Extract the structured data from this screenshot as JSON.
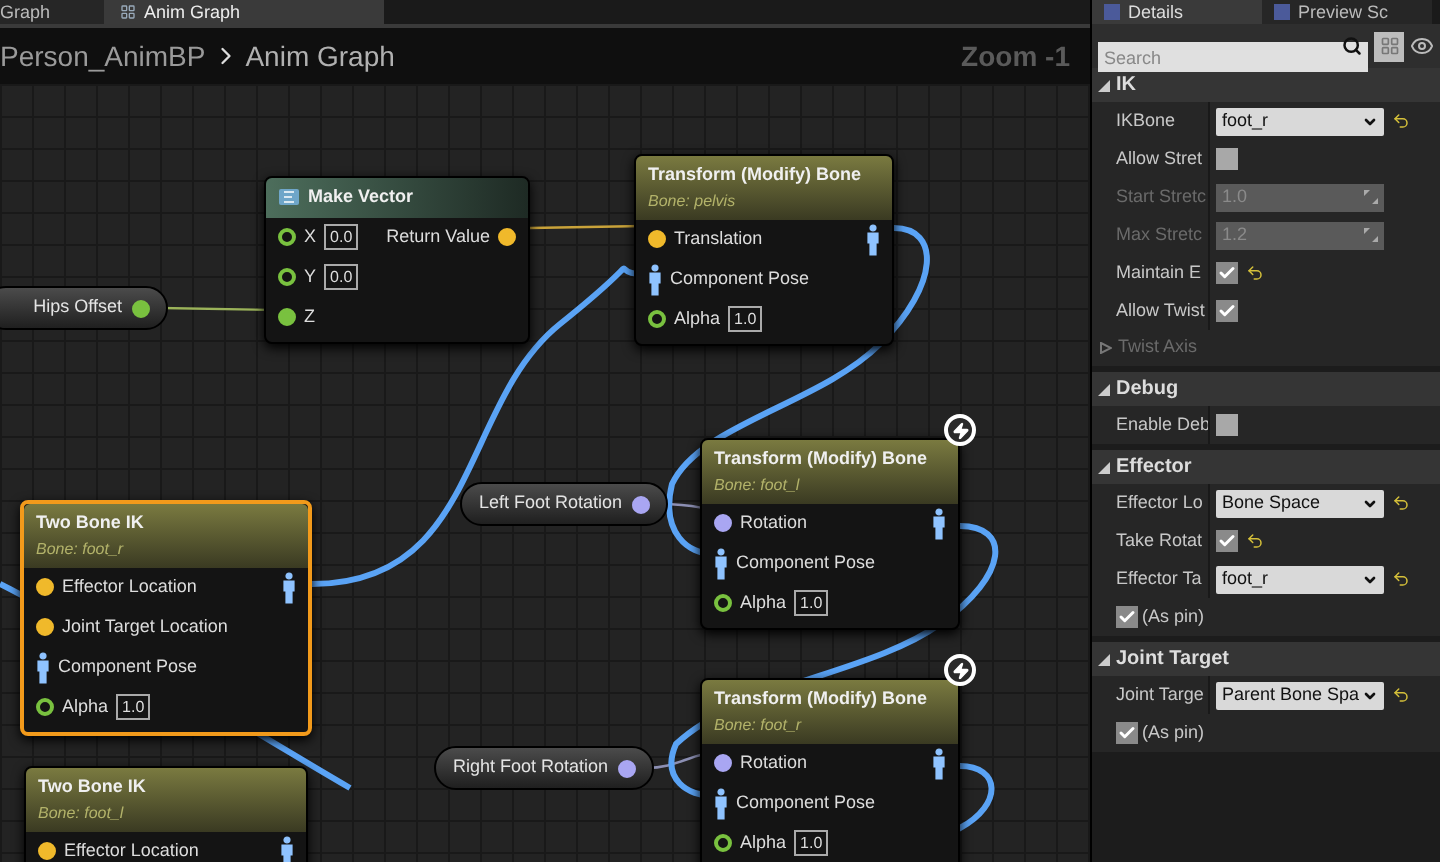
{
  "editor_tabs": [
    {
      "label": "Graph",
      "selected": false
    },
    {
      "label": "Anim Graph",
      "selected": true
    }
  ],
  "breadcrumb": {
    "parent": "Person_AnimBP",
    "current": "Anim Graph",
    "zoom": "Zoom -1"
  },
  "graph": {
    "nodes": [
      {
        "kind": "function",
        "title": "Make Vector",
        "selected": false,
        "inputs": [
          {
            "label": "X",
            "kind": "float",
            "linked": false,
            "value": "0.0"
          },
          {
            "label": "Y",
            "kind": "float",
            "linked": false,
            "value": "0.0"
          },
          {
            "label": "Z",
            "kind": "float",
            "linked": true
          }
        ],
        "outputs": [
          {
            "label": "Return Value",
            "kind": "vector",
            "linked": true
          }
        ]
      },
      {
        "kind": "modify",
        "title": "Transform (Modify) Bone",
        "subtitle": "Bone: pelvis",
        "selected": false,
        "fast_path": false,
        "inputs": [
          {
            "label": "Translation",
            "kind": "vector",
            "linked": true
          },
          {
            "label": "Component Pose",
            "kind": "pose",
            "linked": true
          },
          {
            "label": "Alpha",
            "kind": "float",
            "linked": false,
            "value": "1.0"
          }
        ],
        "outputs": [
          {
            "kind": "pose",
            "linked": true
          }
        ]
      },
      {
        "kind": "variable",
        "title": "Hips Offset",
        "selected": false,
        "outputs": [
          {
            "kind": "float",
            "linked": true
          }
        ]
      },
      {
        "kind": "modify",
        "title": "Two Bone IK",
        "subtitle": "Bone: foot_r",
        "selected": true,
        "fast_path": false,
        "inputs": [
          {
            "label": "Effector Location",
            "kind": "vector",
            "linked": true
          },
          {
            "label": "Joint Target Location",
            "kind": "vector",
            "linked": true
          },
          {
            "label": "Component Pose",
            "kind": "pose",
            "linked": true
          },
          {
            "label": "Alpha",
            "kind": "float",
            "linked": false,
            "value": "1.0"
          }
        ],
        "outputs": [
          {
            "kind": "pose",
            "linked": true
          }
        ]
      },
      {
        "kind": "variable",
        "title": "Left Foot Rotation",
        "selected": false,
        "outputs": [
          {
            "kind": "rotator",
            "linked": true
          }
        ]
      },
      {
        "kind": "modify",
        "title": "Transform (Modify) Bone",
        "subtitle": "Bone: foot_l",
        "selected": false,
        "fast_path": true,
        "inputs": [
          {
            "label": "Rotation",
            "kind": "rotator",
            "linked": true
          },
          {
            "label": "Component Pose",
            "kind": "pose",
            "linked": true
          },
          {
            "label": "Alpha",
            "kind": "float",
            "linked": false,
            "value": "1.0"
          }
        ],
        "outputs": [
          {
            "kind": "pose",
            "linked": true
          }
        ]
      },
      {
        "kind": "modify",
        "title": "Two Bone IK",
        "subtitle": "Bone: foot_l",
        "selected": false,
        "fast_path": false,
        "inputs": [
          {
            "label": "Effector Location",
            "kind": "vector",
            "linked": true
          }
        ],
        "outputs": [
          {
            "kind": "pose",
            "linked": true
          }
        ]
      },
      {
        "kind": "variable",
        "title": "Right Foot Rotation",
        "selected": false,
        "outputs": [
          {
            "kind": "rotator",
            "linked": true
          }
        ]
      },
      {
        "kind": "modify",
        "title": "Transform (Modify) Bone",
        "subtitle": "Bone: foot_r",
        "selected": false,
        "fast_path": true,
        "inputs": [
          {
            "label": "Rotation",
            "kind": "rotator",
            "linked": true
          },
          {
            "label": "Component Pose",
            "kind": "pose",
            "linked": true
          },
          {
            "label": "Alpha",
            "kind": "float",
            "linked": false,
            "value": "1.0"
          }
        ],
        "outputs": [
          {
            "kind": "pose",
            "linked": true
          }
        ]
      }
    ]
  },
  "details": {
    "tabs": [
      {
        "label": "Details",
        "selected": true
      },
      {
        "label": "Preview Sc",
        "selected": false
      }
    ],
    "search": {
      "placeholder": "Search"
    },
    "sections": [
      {
        "title": "IK",
        "expanded": true,
        "rows": [
          {
            "kind": "dropdown",
            "label": "IKBone",
            "value": "foot_r",
            "disabled": false,
            "reset": true
          },
          {
            "kind": "checkbox",
            "label": "Allow Stret",
            "checked": false,
            "disabled": false,
            "reset": false
          },
          {
            "kind": "spin",
            "label": "Start Stretc",
            "value": "1.0",
            "disabled": true
          },
          {
            "kind": "spin",
            "label": "Max Stretc",
            "value": "1.2",
            "disabled": true
          },
          {
            "kind": "checkbox",
            "label": "Maintain E",
            "checked": true,
            "disabled": false,
            "reset": true
          },
          {
            "kind": "checkbox",
            "label": "Allow Twist",
            "checked": true,
            "disabled": false,
            "reset": false
          },
          {
            "kind": "group",
            "label": "Twist Axis",
            "disabled": true
          }
        ]
      },
      {
        "title": "Debug",
        "expanded": true,
        "rows": [
          {
            "kind": "checkbox",
            "label": "Enable Deb",
            "checked": false,
            "disabled": false,
            "reset": false
          }
        ]
      },
      {
        "title": "Effector",
        "expanded": true,
        "rows": [
          {
            "kind": "dropdown",
            "label": "Effector Lo",
            "value": "Bone Space",
            "disabled": false,
            "reset": true
          },
          {
            "kind": "checkbox",
            "label": "Take Rotat",
            "checked": true,
            "disabled": false,
            "reset": true
          },
          {
            "kind": "dropdown",
            "label": "Effector Ta",
            "value": "foot_r",
            "disabled": false,
            "reset": true
          },
          {
            "kind": "pin",
            "label": "(As pin)",
            "checked": true
          }
        ]
      },
      {
        "title": "Joint Target",
        "expanded": true,
        "rows": [
          {
            "kind": "dropdown",
            "label": "Joint Targe",
            "value": "Parent Bone Spa",
            "disabled": false,
            "reset": true
          },
          {
            "kind": "pin",
            "label": "(As pin)",
            "checked": true
          }
        ]
      }
    ]
  }
}
